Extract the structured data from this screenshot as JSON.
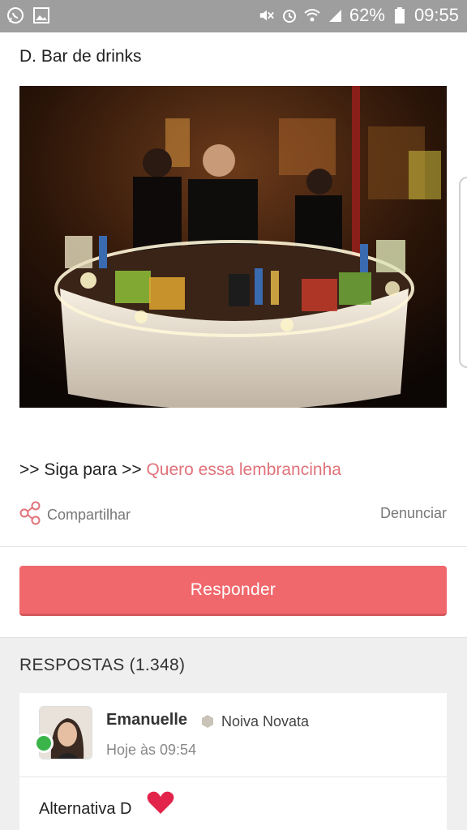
{
  "status_bar": {
    "battery_percent": "62%",
    "time": "09:55",
    "icons": [
      "whatsapp-icon",
      "image-icon",
      "mute-icon",
      "alarm-icon",
      "wifi-icon",
      "signal-icon",
      "battery-icon"
    ]
  },
  "post": {
    "title": "D. Bar de drinks",
    "image_alt": "Bar de drinks"
  },
  "follow": {
    "prefix": ">> Siga para >> ",
    "link_text": "Quero essa lembrancinha"
  },
  "actions": {
    "share_label": "Compartilhar",
    "report_label": "Denunciar"
  },
  "reply_button": {
    "label": "Responder"
  },
  "answers": {
    "header": "RESPOSTAS (1.348)",
    "items": [
      {
        "author": "Emanuelle",
        "role": "Noiva Novata",
        "time": "Hoje às 09:54",
        "text": "Alternativa D"
      }
    ]
  },
  "colors": {
    "accent": "#f0686c",
    "link": "#e0737a",
    "status_bar": "#9e9e9e",
    "online": "#3bb54a"
  }
}
